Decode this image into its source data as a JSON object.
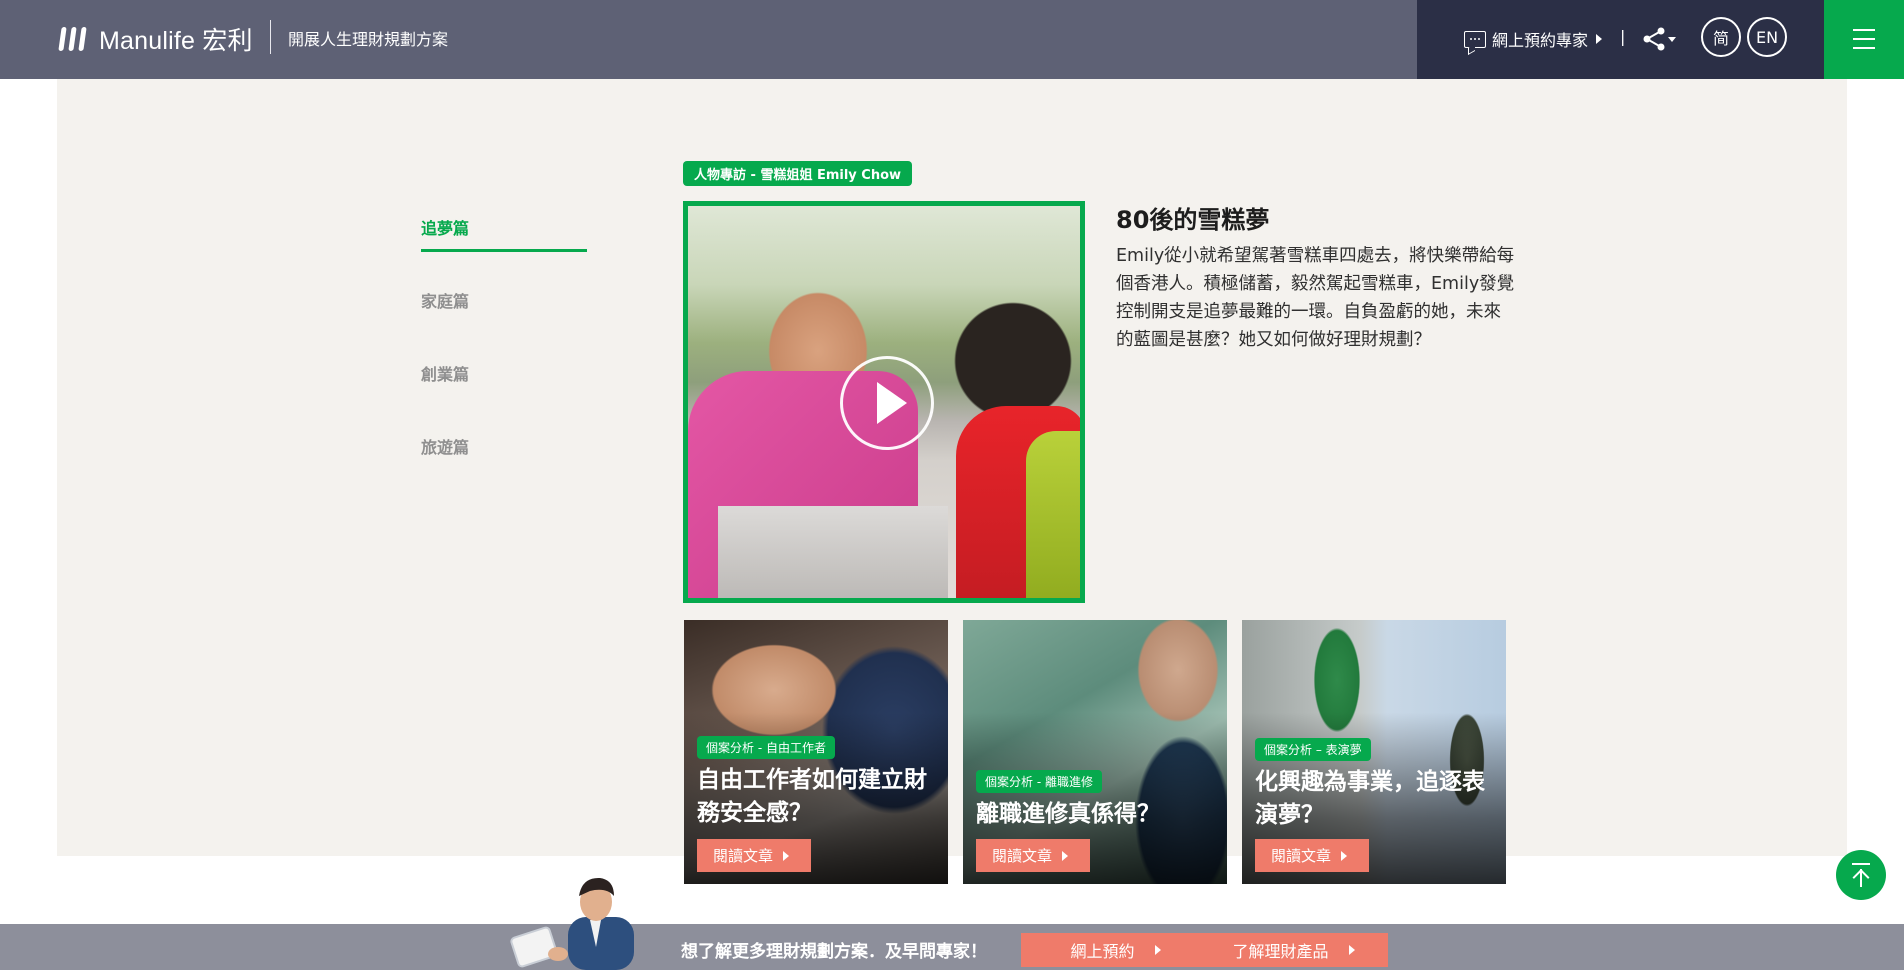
{
  "header": {
    "brand": "Manulife 宏利",
    "slogan": "開展人生理財規劃方案",
    "booking_label": "網上預約專家",
    "separator": "|",
    "lang_sc": "简",
    "lang_en": "EN"
  },
  "sidenav": {
    "items": [
      {
        "label": "追夢篇",
        "active": true
      },
      {
        "label": "家庭篇",
        "active": false
      },
      {
        "label": "創業篇",
        "active": false
      },
      {
        "label": "旅遊篇",
        "active": false
      }
    ]
  },
  "feature": {
    "tag": "人物專訪 - 雪糕姐姐 Emily Chow",
    "title": "80後的雪糕夢",
    "description": "Emily從小就希望駕著雪糕車四處去，將快樂帶給每個香港人。積極儲蓄，毅然駕起雪糕車，Emily發覺控制開支是追夢最難的一環。自負盈虧的她，未來的藍圖是甚麼？她又如何做好理財規劃？"
  },
  "cards": [
    {
      "tag": "個案分析 - 自由工作者",
      "title": "自由工作者如何建立財務安全感？",
      "button": "閱讀文章"
    },
    {
      "tag": "個案分析 - 離職進修",
      "title": "離職進修真係得？",
      "button": "閱讀文章"
    },
    {
      "tag": "個案分析 – 表演夢",
      "title": "化興趣為事業，追逐表演夢？",
      "button": "閱讀文章"
    }
  ],
  "cta": {
    "text": "想了解更多理財規劃方案．及早問專家！",
    "btn_booking": "網上預約",
    "btn_products": "了解理財產品"
  },
  "colors": {
    "header_bg": "#5e6175",
    "header_right_bg": "#2b2f46",
    "brand_green": "#06a94d",
    "accent_coral": "#ef7b6a",
    "content_bg": "#f4f2ee",
    "cta_bg": "#8d8f9b"
  },
  "icons": [
    "manulife-logo-icon",
    "chat-icon",
    "share-icon",
    "hamburger-menu-icon",
    "play-icon",
    "back-to-top-icon",
    "triangle-right-icon"
  ]
}
